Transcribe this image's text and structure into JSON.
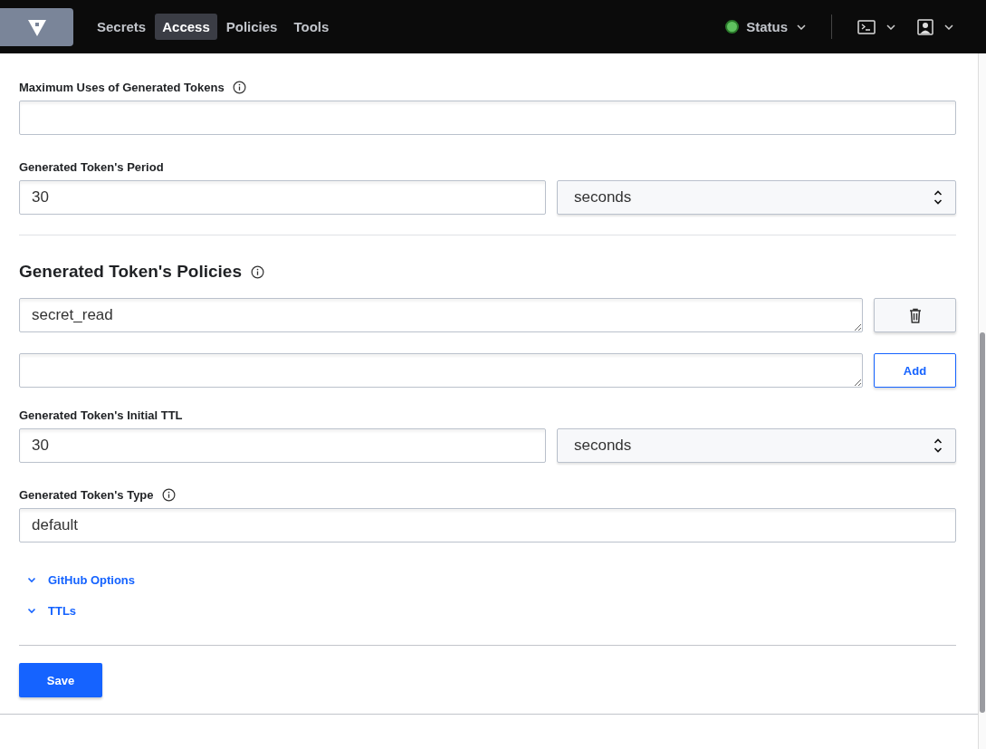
{
  "nav": {
    "tabs": [
      {
        "label": "Secrets",
        "selected": false
      },
      {
        "label": "Access",
        "selected": true
      },
      {
        "label": "Policies",
        "selected": false
      },
      {
        "label": "Tools",
        "selected": false
      }
    ],
    "status": {
      "label": "Status",
      "color": "#5fc15f"
    }
  },
  "max_uses": {
    "label": "Maximum Uses of Generated Tokens"
  },
  "period": {
    "label": "Generated Token's Period",
    "value": "30",
    "unit": "seconds"
  },
  "policies": {
    "heading": "Generated Token's Policies",
    "items": [
      "secret_read"
    ],
    "add_button": "Add"
  },
  "initial_ttl": {
    "label": "Generated Token's Initial TTL",
    "value": "30",
    "unit": "seconds"
  },
  "token_type": {
    "label": "Generated Token's Type",
    "value": "default"
  },
  "sections": [
    {
      "label": "GitHub Options",
      "expanded": false
    },
    {
      "label": "TTLs",
      "expanded": false
    }
  ],
  "save_button": "Save"
}
